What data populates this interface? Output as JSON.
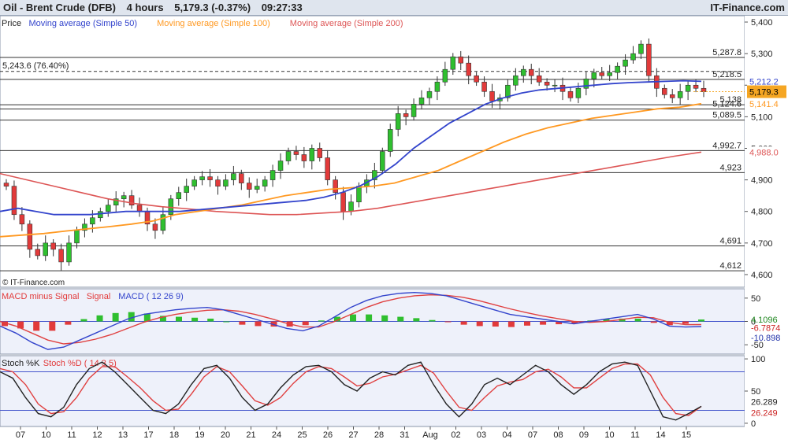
{
  "header": {
    "instrument": "Oil - Brent Crude (DFB)",
    "timeframe": "4 hours",
    "price_change": "5,179.3 (-0.37%)",
    "time": "09:27:33",
    "brand": "IT-Finance.com"
  },
  "watermark": "© IT-Finance.com",
  "colors": {
    "up_candle": "#2fbf2f",
    "down_candle": "#e23a3a",
    "ma50": "#3344cc",
    "ma100": "#ff9922",
    "ma200": "#dd5555",
    "panel_bg": "#ffffff",
    "indicator_bg": "#eef1fa"
  },
  "chart_data": [
    {
      "type": "candlestick",
      "panel": "price",
      "legend": [
        "Price",
        "Moving average (Simple 50)",
        "Moving average (Simple 100)",
        "Moving average (Simple 200)"
      ],
      "ylim": [
        4560,
        5420
      ],
      "y_ticks": [
        4600,
        4700,
        4800,
        4900,
        5000,
        5100,
        5200,
        5300,
        5400
      ],
      "y_tick_labels": [
        "4,600",
        "4,700",
        "4,800",
        "4,900",
        "5,000",
        "5,100",
        "5,200",
        "5,300",
        "5,400"
      ],
      "x_ticks": [
        "07",
        "10",
        "11",
        "12",
        "13",
        "17",
        "18",
        "19",
        "20",
        "21",
        "24",
        "25",
        "26",
        "27",
        "28",
        "31",
        "Aug",
        "02",
        "03",
        "04",
        "07",
        "08",
        "09",
        "10",
        "11",
        "14",
        "15"
      ],
      "horizontal_levels": [
        {
          "value": 5287.8,
          "label": "5,287.8"
        },
        {
          "value": 5218.5,
          "label": "5,218.5"
        },
        {
          "value": 5138,
          "label": "5,138"
        },
        {
          "value": 5124.6,
          "label": "5,124.6"
        },
        {
          "value": 5089.5,
          "label": "5,089.5"
        },
        {
          "value": 4992.7,
          "label": "4,992.7"
        },
        {
          "value": 4923,
          "label": "4,923"
        },
        {
          "value": 4691,
          "label": "4,691"
        },
        {
          "value": 4612,
          "label": "4,612"
        }
      ],
      "fib_level": {
        "value": 5243.6,
        "label": "5,243.6 (76.40%)"
      },
      "current_price": {
        "value": 5179.3,
        "label": "5,179.3"
      },
      "ma_values": [
        {
          "name": "Moving average (Simple 50)",
          "value": 5212.2,
          "label": "5,212.2"
        },
        {
          "name": "Moving average (Simple 100)",
          "value": 5141.4,
          "label": "5,141.4"
        },
        {
          "name": "Moving average (Simple 200)",
          "value": 4988.0,
          "label": "4,988.0"
        }
      ],
      "close_path": [
        4880,
        4790,
        4760,
        4680,
        4660,
        4700,
        4680,
        4640,
        4700,
        4740,
        4760,
        4780,
        4800,
        4820,
        4840,
        4850,
        4820,
        4800,
        4760,
        4740,
        4790,
        4840,
        4860,
        4880,
        4900,
        4910,
        4900,
        4880,
        4900,
        4920,
        4890,
        4870,
        4880,
        4900,
        4930,
        4960,
        4990,
        4980,
        4960,
        5000,
        4970,
        4900,
        4860,
        4800,
        4830,
        4880,
        4900,
        4930,
        4990,
        5060,
        5110,
        5100,
        5140,
        5160,
        5180,
        5210,
        5250,
        5290,
        5270,
        5230,
        5210,
        5180,
        5150,
        5160,
        5200,
        5230,
        5250,
        5230,
        5210,
        5200,
        5200,
        5180,
        5160,
        5190,
        5220,
        5240,
        5230,
        5240,
        5260,
        5280,
        5300,
        5330,
        5230,
        5190,
        5170,
        5160,
        5180,
        5200,
        5190,
        5179.3
      ],
      "ma50_path": [
        4800,
        4810,
        4800,
        4790,
        4790,
        4790,
        4795,
        4800,
        4800,
        4800,
        4800,
        4805,
        4810,
        4815,
        4820,
        4825,
        4830,
        4835,
        4845,
        4860,
        4880,
        4910,
        4950,
        5000,
        5040,
        5080,
        5110,
        5140,
        5160,
        5175,
        5185,
        5190,
        5195,
        5200,
        5205,
        5208,
        5210,
        5212,
        5214,
        5212.2
      ],
      "ma100_path": [
        4720,
        4725,
        4730,
        4738,
        4745,
        4752,
        4760,
        4770,
        4790,
        4800,
        4810,
        4820,
        4835,
        4850,
        4860,
        4870,
        4875,
        4880,
        4890,
        4910,
        4930,
        4960,
        4990,
        5020,
        5045,
        5065,
        5080,
        5095,
        5105,
        5115,
        5125,
        5130,
        5141.4
      ],
      "ma200_path": [
        4920,
        4900,
        4880,
        4860,
        4840,
        4825,
        4815,
        4808,
        4800,
        4795,
        4790,
        4790,
        4795,
        4800,
        4810,
        4825,
        4840,
        4855,
        4870,
        4885,
        4900,
        4915,
        4930,
        4945,
        4960,
        4975,
        4988.0
      ]
    },
    {
      "type": "histogram+line",
      "panel": "macd",
      "legend": [
        "MACD minus Signal",
        "Signal",
        "MACD ( 12 26 9)"
      ],
      "ylim": [
        -70,
        70
      ],
      "y_ticks": [
        50,
        0,
        -50
      ],
      "y_tick_labels": [
        "50",
        "0",
        "-50"
      ],
      "values_labels": [
        "4.1096",
        "-6.7874",
        "-10.898"
      ],
      "macd_path": [
        -10,
        -25,
        -45,
        -60,
        -55,
        -40,
        -25,
        -10,
        5,
        15,
        20,
        25,
        28,
        30,
        25,
        15,
        5,
        -5,
        -15,
        -20,
        -10,
        10,
        30,
        45,
        55,
        60,
        62,
        60,
        55,
        45,
        35,
        25,
        15,
        10,
        5,
        0,
        -5,
        0,
        5,
        10,
        15,
        5,
        -10,
        -12,
        -10.898
      ],
      "signal_path": [
        0,
        -10,
        -25,
        -40,
        -48,
        -45,
        -38,
        -28,
        -15,
        -2,
        8,
        15,
        20,
        24,
        25,
        22,
        15,
        6,
        -4,
        -12,
        -12,
        0,
        15,
        30,
        42,
        50,
        55,
        57,
        56,
        52,
        45,
        36,
        27,
        19,
        12,
        6,
        0,
        -2,
        0,
        4,
        9,
        8,
        -2,
        -7,
        -6.7874
      ],
      "hist_path": [
        -10,
        -15,
        -20,
        -20,
        -7,
        5,
        13,
        18,
        20,
        17,
        12,
        10,
        8,
        6,
        0,
        -7,
        -10,
        -11,
        -11,
        -8,
        2,
        10,
        15,
        15,
        13,
        10,
        7,
        3,
        -1,
        -7,
        -10,
        -11,
        -12,
        -9,
        -7,
        -6,
        -5,
        2,
        5,
        6,
        6,
        -3,
        -8,
        -5,
        4.1096
      ]
    },
    {
      "type": "line",
      "panel": "stochastic",
      "legend": [
        "Stoch %K",
        "Stoch %D ( 14 3 5)"
      ],
      "ylim": [
        -5,
        105
      ],
      "y_ticks": [
        100,
        50,
        0
      ],
      "y_tick_labels": [
        "100",
        "50",
        "0"
      ],
      "reference_lines": [
        80,
        20
      ],
      "values_labels": [
        "26.289",
        "26.249"
      ],
      "k_path": [
        80,
        70,
        40,
        15,
        10,
        25,
        60,
        85,
        95,
        80,
        60,
        40,
        20,
        15,
        30,
        60,
        85,
        90,
        70,
        40,
        20,
        30,
        55,
        75,
        88,
        90,
        80,
        60,
        50,
        70,
        80,
        75,
        90,
        95,
        60,
        30,
        10,
        30,
        60,
        70,
        60,
        75,
        90,
        80,
        60,
        45,
        60,
        80,
        92,
        95,
        90,
        50,
        10,
        5,
        15,
        26.289
      ],
      "d_path": [
        85,
        80,
        60,
        30,
        15,
        18,
        40,
        70,
        88,
        88,
        72,
        55,
        35,
        20,
        22,
        45,
        72,
        88,
        80,
        58,
        35,
        28,
        40,
        62,
        80,
        88,
        85,
        72,
        58,
        62,
        72,
        76,
        83,
        90,
        78,
        50,
        25,
        20,
        40,
        58,
        64,
        68,
        80,
        84,
        72,
        55,
        55,
        70,
        85,
        92,
        92,
        75,
        40,
        15,
        12,
        26.249
      ]
    }
  ]
}
